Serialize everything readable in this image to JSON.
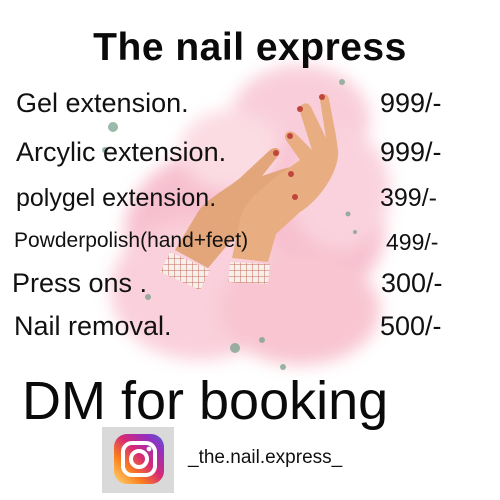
{
  "title": "The nail express",
  "menu": [
    {
      "item": "Gel extension.",
      "price": "999/-"
    },
    {
      "item": "Arcylic extension.",
      "price": "999/-"
    },
    {
      "item": "polygel extension.",
      "price": "399/-"
    },
    {
      "item": "Powderpolish(hand+feet)",
      "price": "499/-"
    },
    {
      "item": "Press ons .",
      "price": "300/-"
    },
    {
      "item": "Nail removal.",
      "price": "500/-"
    }
  ],
  "cta": "DM for booking",
  "instagram": {
    "handle": "_the.nail.express_",
    "icon": "instagram-icon"
  },
  "colors": {
    "splash": "#f6b6c8",
    "skin": "#e2a67a",
    "text": "#111111"
  }
}
